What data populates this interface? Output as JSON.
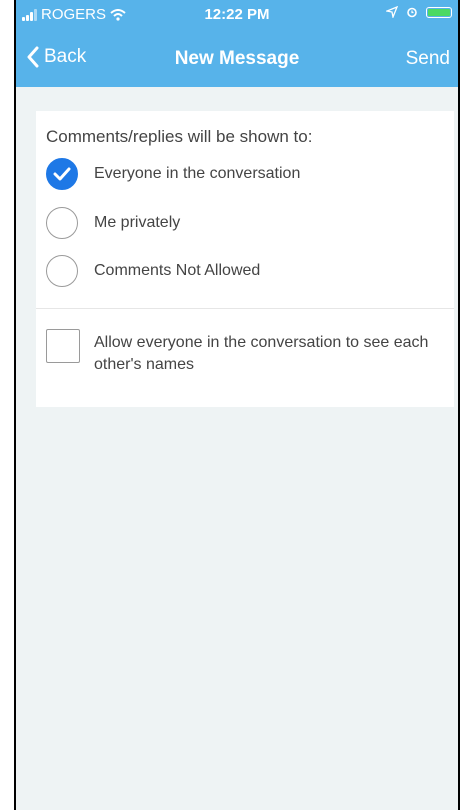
{
  "status_bar": {
    "carrier": "ROGERS",
    "time": "12:22 PM"
  },
  "nav": {
    "back_label": "Back",
    "title": "New Message",
    "send_label": "Send"
  },
  "visibility": {
    "heading": "Comments/replies will be shown to:",
    "options": [
      {
        "label": "Everyone in the conversation",
        "checked": true
      },
      {
        "label": "Me privately",
        "checked": false
      },
      {
        "label": "Comments Not Allowed",
        "checked": false
      }
    ]
  },
  "names_option": {
    "label": "Allow everyone in the conversation to see each other's names",
    "checked": false
  },
  "colors": {
    "header": "#57b3ea",
    "accent": "#1e78e6",
    "background": "#eef3f4"
  },
  "icons": {
    "back": "chevron-left-icon",
    "checked_radio": "checkmark-icon",
    "wifi": "wifi-icon",
    "location": "location-arrow-icon",
    "alarm": "alarm-clock-icon",
    "battery": "battery-icon"
  }
}
